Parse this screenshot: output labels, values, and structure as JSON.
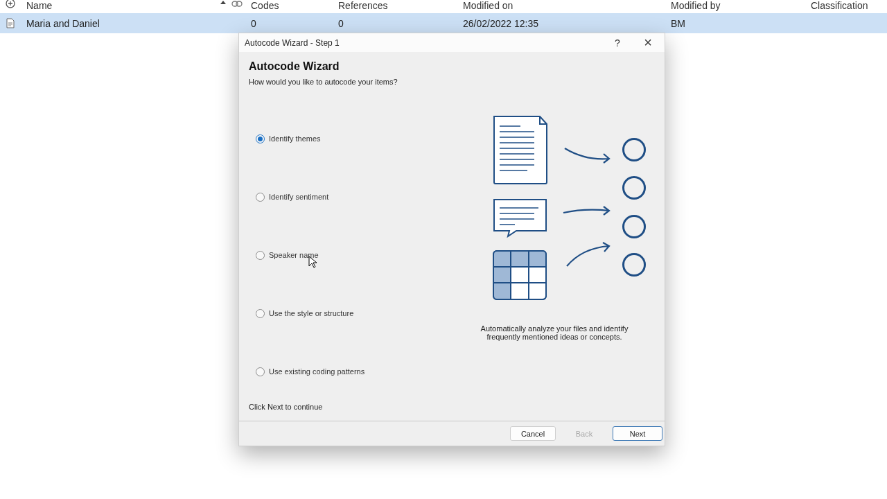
{
  "table": {
    "columns": [
      "Name",
      "Codes",
      "References",
      "Modified on",
      "Modified by",
      "Classification"
    ],
    "rows": [
      {
        "cells": [
          "Maria and Daniel",
          "0",
          "0",
          "26/02/2022 12:35",
          "BM",
          ""
        ],
        "selected": true
      }
    ]
  },
  "dialog": {
    "title": "Autocode Wizard - Step 1",
    "help": "?",
    "close": "×",
    "heading": "Autocode Wizard",
    "subtitle": "How would you like to autocode your items?",
    "options": [
      {
        "label": "Identify themes",
        "selected": true
      },
      {
        "label": "Identify sentiment",
        "selected": false
      },
      {
        "label": "Speaker name",
        "selected": false
      },
      {
        "label": "Use the style or structure",
        "selected": false
      },
      {
        "label": "Use existing coding patterns",
        "selected": false
      }
    ],
    "description": "Automatically analyze your files and identify frequently mentioned ideas or concepts.",
    "hint": "Click Next to continue",
    "buttons": [
      {
        "label": "Cancel",
        "disabled": false,
        "default": false
      },
      {
        "label": "Back",
        "disabled": true,
        "default": false
      },
      {
        "label": "Next",
        "disabled": false,
        "default": true
      }
    ]
  }
}
